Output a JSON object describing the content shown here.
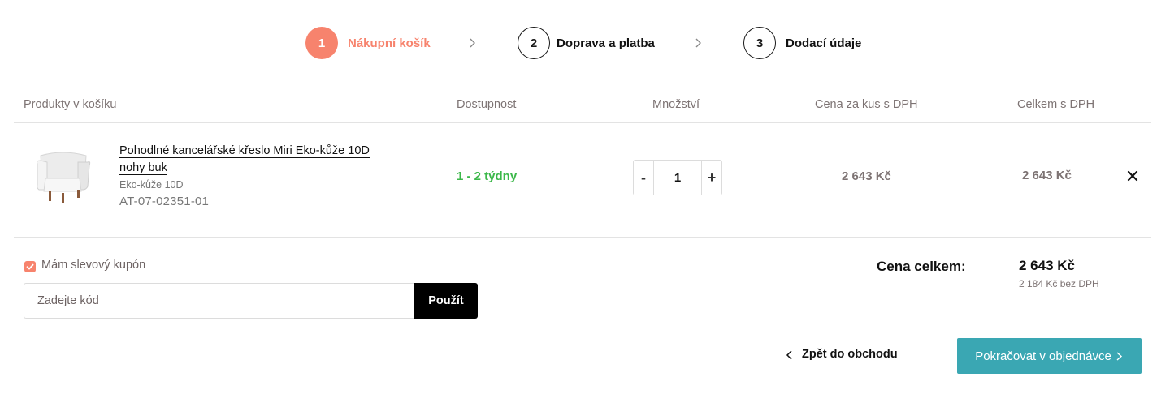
{
  "steps": [
    {
      "number": "1",
      "label": "Nákupní košík"
    },
    {
      "number": "2",
      "label": "Doprava a platba"
    },
    {
      "number": "3",
      "label": "Dodací údaje"
    }
  ],
  "table_headers": {
    "products": "Produkty v košíku",
    "availability": "Dostupnost",
    "quantity": "Množství",
    "unit_price": "Cena za kus s DPH",
    "total": "Celkem s DPH"
  },
  "item": {
    "name": "Pohodlné kancelářské křeslo Miri Eko-kůže 10D nohy buk",
    "variant": "Eko-kůže 10D",
    "code": "AT-07-02351-01",
    "availability": "1 - 2 týdny",
    "quantity": "1",
    "minus_label": "-",
    "plus_label": "+",
    "unit_price": "2 643 Kč",
    "total_price": "2 643 Kč"
  },
  "coupon": {
    "checkbox_label": "Mám slevový kupón",
    "checked": true,
    "placeholder": "Zadejte kód",
    "apply_label": "Použít"
  },
  "summary": {
    "label": "Cena celkem:",
    "total": "2 643 Kč",
    "without_vat": "2 184 Kč bez DPH"
  },
  "actions": {
    "back_label": "Zpět do obchodu",
    "continue_label": "Pokračovat v objednávce"
  },
  "colors": {
    "accent": "#f7836d",
    "available": "#3cb84a",
    "primary_button": "#3aa7b3",
    "muted_text": "#7d7373"
  }
}
